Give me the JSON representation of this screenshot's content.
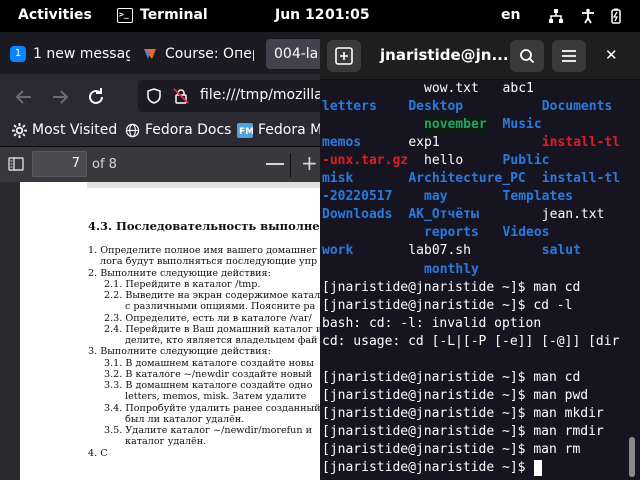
{
  "topbar": {
    "activities": "Activities",
    "app_name": "Terminal",
    "date": "Jun 12",
    "time": "01:05",
    "keyboard_layout": "en",
    "tray_icons": [
      "network-icon",
      "accessibility-icon",
      "battery-icon"
    ]
  },
  "firefox": {
    "tabs": [
      {
        "label": "1 new messag",
        "badge": "1",
        "icon": "message-badge-icon"
      },
      {
        "label": "Course: Опер",
        "icon": "course-favicon-icon"
      },
      {
        "label": "004-la",
        "active": true
      }
    ],
    "nav": {
      "url": "file:///tmp/mozilla",
      "back_icon": "back-arrow-icon",
      "forward_icon": "forward-arrow-icon",
      "reload_icon": "reload-icon"
    },
    "bookmarks": [
      {
        "label": "Most Visited",
        "icon": "gear-icon"
      },
      {
        "label": "Fedora Docs",
        "icon": "globe-icon"
      },
      {
        "label": "Fedora M",
        "icon": "fedora-magazine-icon"
      }
    ],
    "pdf_toolbar": {
      "page_number": "7",
      "page_count_label": "of 8"
    },
    "pdf_content": {
      "section_title": "4.3.   Последовательность выполнени",
      "lines": [
        {
          "text": "1.   Определите полное имя вашего домашнег",
          "indent": 0
        },
        {
          "text": "лога будут выполняться последующие упр",
          "indent": 1
        },
        {
          "text": "2.   Выполните следующие действия:",
          "indent": 0
        },
        {
          "text": "2.1.   Перейдите в каталог /tmp.",
          "indent": 2
        },
        {
          "text": "2.2.   Выведите на экран содержимое катало",
          "indent": 2
        },
        {
          "text": "с различными опциями. Поясните ра",
          "indent": 3
        },
        {
          "text": "2.3.   Определите, есть ли в каталоге /var/",
          "indent": 2
        },
        {
          "text": "2.4.   Перейдите в Ваш домашний каталог и",
          "indent": 2
        },
        {
          "text": "делите, кто является владельцем фай",
          "indent": 3
        },
        {
          "text": "3.   Выполните следующие действия:",
          "indent": 0
        },
        {
          "text": "3.1.   В домашнем каталоге создайте новы",
          "indent": 2
        },
        {
          "text": "3.2.   В каталоге ~/newdir создайте новый",
          "indent": 2
        },
        {
          "text": "3.3.   В домашнем каталоге создайте одно",
          "indent": 2
        },
        {
          "text": "letters, memos, misk. Затем удалите",
          "indent": 3
        },
        {
          "text": "3.4.   Попробуйте удалить ранее созданный",
          "indent": 2
        },
        {
          "text": "был ли каталог удалён.",
          "indent": 3
        },
        {
          "text": "3.5.   Удалите каталог ~/newdir/morefun и",
          "indent": 2
        },
        {
          "text": "каталог удалён.",
          "indent": 3
        },
        {
          "text": "4.   C",
          "indent": 0
        }
      ]
    }
  },
  "terminal": {
    "title": "jnaristide@jn...",
    "new_tab_icon": "new-tab-plus-icon",
    "search_icon": "search-icon",
    "menu_icon": "hamburger-menu-icon",
    "close_icon": "close-icon",
    "listing": [
      [
        {
          "text": "wow.txt",
          "col": 13,
          "cls": "c-plain"
        },
        {
          "text": "abc1",
          "col": 23,
          "cls": "c-plain"
        }
      ],
      [
        {
          "text": "letters",
          "col": 0,
          "cls": "c-dir"
        },
        {
          "text": "Desktop",
          "col": 11,
          "cls": "c-dir"
        },
        {
          "text": "Documents",
          "col": 28,
          "cls": "c-dir"
        }
      ],
      [
        {
          "text": "november",
          "col": 13,
          "cls": "c-green"
        },
        {
          "text": "Music",
          "col": 23,
          "cls": "c-dir"
        }
      ],
      [
        {
          "text": "memos",
          "col": 0,
          "cls": "c-dir"
        },
        {
          "text": "exp1",
          "col": 11,
          "cls": "c-plain"
        },
        {
          "text": "install-tl",
          "col": 28,
          "cls": "c-arch"
        }
      ],
      [
        {
          "text": "-unx.tar.gz",
          "col": 0,
          "cls": "c-arch"
        },
        {
          "text": "hello",
          "col": 13,
          "cls": "c-plain"
        },
        {
          "text": "Public",
          "col": 23,
          "cls": "c-dir"
        }
      ],
      [
        {
          "text": "misk",
          "col": 0,
          "cls": "c-dir"
        },
        {
          "text": "Architecture_PC",
          "col": 11,
          "cls": "c-dir"
        },
        {
          "text": "install-tl",
          "col": 28,
          "cls": "c-dir"
        }
      ],
      [
        {
          "text": "-20220517",
          "col": 0,
          "cls": "c-dir"
        },
        {
          "text": "may",
          "col": 13,
          "cls": "c-dir"
        },
        {
          "text": "Templates",
          "col": 23,
          "cls": "c-dir"
        }
      ],
      [
        {
          "text": "Downloads",
          "col": 0,
          "cls": "c-dir"
        },
        {
          "text": "AK_Отчёты",
          "col": 11,
          "cls": "c-dir"
        },
        {
          "text": "jean.txt",
          "col": 28,
          "cls": "c-plain"
        }
      ],
      [
        {
          "text": "reports",
          "col": 13,
          "cls": "c-dir"
        },
        {
          "text": "Videos",
          "col": 23,
          "cls": "c-dir"
        }
      ],
      [
        {
          "text": "work",
          "col": 0,
          "cls": "c-dir"
        },
        {
          "text": "lab07.sh",
          "col": 11,
          "cls": "c-plain"
        },
        {
          "text": "salut",
          "col": 28,
          "cls": "c-dir"
        }
      ],
      [
        {
          "text": "monthly",
          "col": 13,
          "cls": "c-dir"
        }
      ]
    ],
    "lines": [
      "[jnaristide@jnaristide ~]$ man cd",
      "[jnaristide@jnaristide ~]$ cd -l",
      "bash: cd: -l: invalid option",
      "cd: usage: cd [-L|[-P [-e]] [-@]] [dir",
      "",
      "[jnaristide@jnaristide ~]$ man cd",
      "[jnaristide@jnaristide ~]$ man pwd",
      "[jnaristide@jnaristide ~]$ man mkdir",
      "[jnaristide@jnaristide ~]$ man rmdir",
      "[jnaristide@jnaristide ~]$ man rm",
      "[jnaristide@jnaristide ~]$ "
    ]
  }
}
